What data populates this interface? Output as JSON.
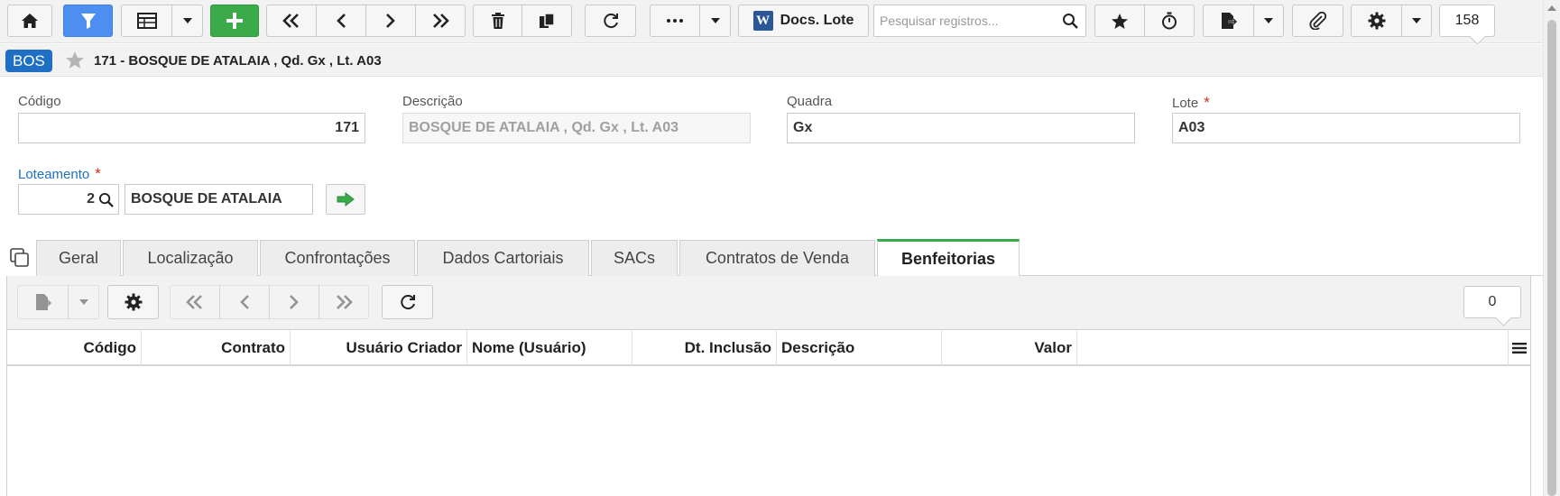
{
  "toolbar": {
    "home_icon": "home-icon",
    "filter_icon": "filter-icon",
    "table_icon": "table-icon",
    "add_icon": "plus-icon",
    "docs_label": "Docs. Lote",
    "search_placeholder": "Pesquisar registros...",
    "record_count": "158",
    "colors": {
      "filter": "#4d8ff0",
      "add": "#3bab4a"
    }
  },
  "titlebar": {
    "badge": "BOS",
    "title": "171 - BOSQUE DE ATALAIA , Qd. Gx , Lt. A03"
  },
  "form": {
    "codigo": {
      "label": "Código",
      "value": "171"
    },
    "descricao": {
      "label": "Descrição",
      "value": "BOSQUE DE ATALAIA ,  Qd. Gx ,  Lt. A03"
    },
    "quadra": {
      "label": "Quadra",
      "value": "Gx"
    },
    "lote": {
      "label": "Lote",
      "required": "*",
      "value": "A03"
    },
    "loteamento": {
      "label": "Loteamento",
      "required": "*",
      "code": "2",
      "name": "BOSQUE DE ATALAIA"
    }
  },
  "tabs": [
    {
      "label": "Geral"
    },
    {
      "label": "Localização"
    },
    {
      "label": "Confrontações"
    },
    {
      "label": "Dados Cartoriais"
    },
    {
      "label": "SACs"
    },
    {
      "label": "Contratos de Venda"
    },
    {
      "label": "Benfeitorias",
      "active": true
    }
  ],
  "grid": {
    "record_count": "0",
    "columns": [
      "Código",
      "Contrato",
      "Usuário Criador",
      "Nome (Usuário)",
      "Dt. Inclusão",
      "Descrição",
      "Valor"
    ],
    "rows": []
  }
}
